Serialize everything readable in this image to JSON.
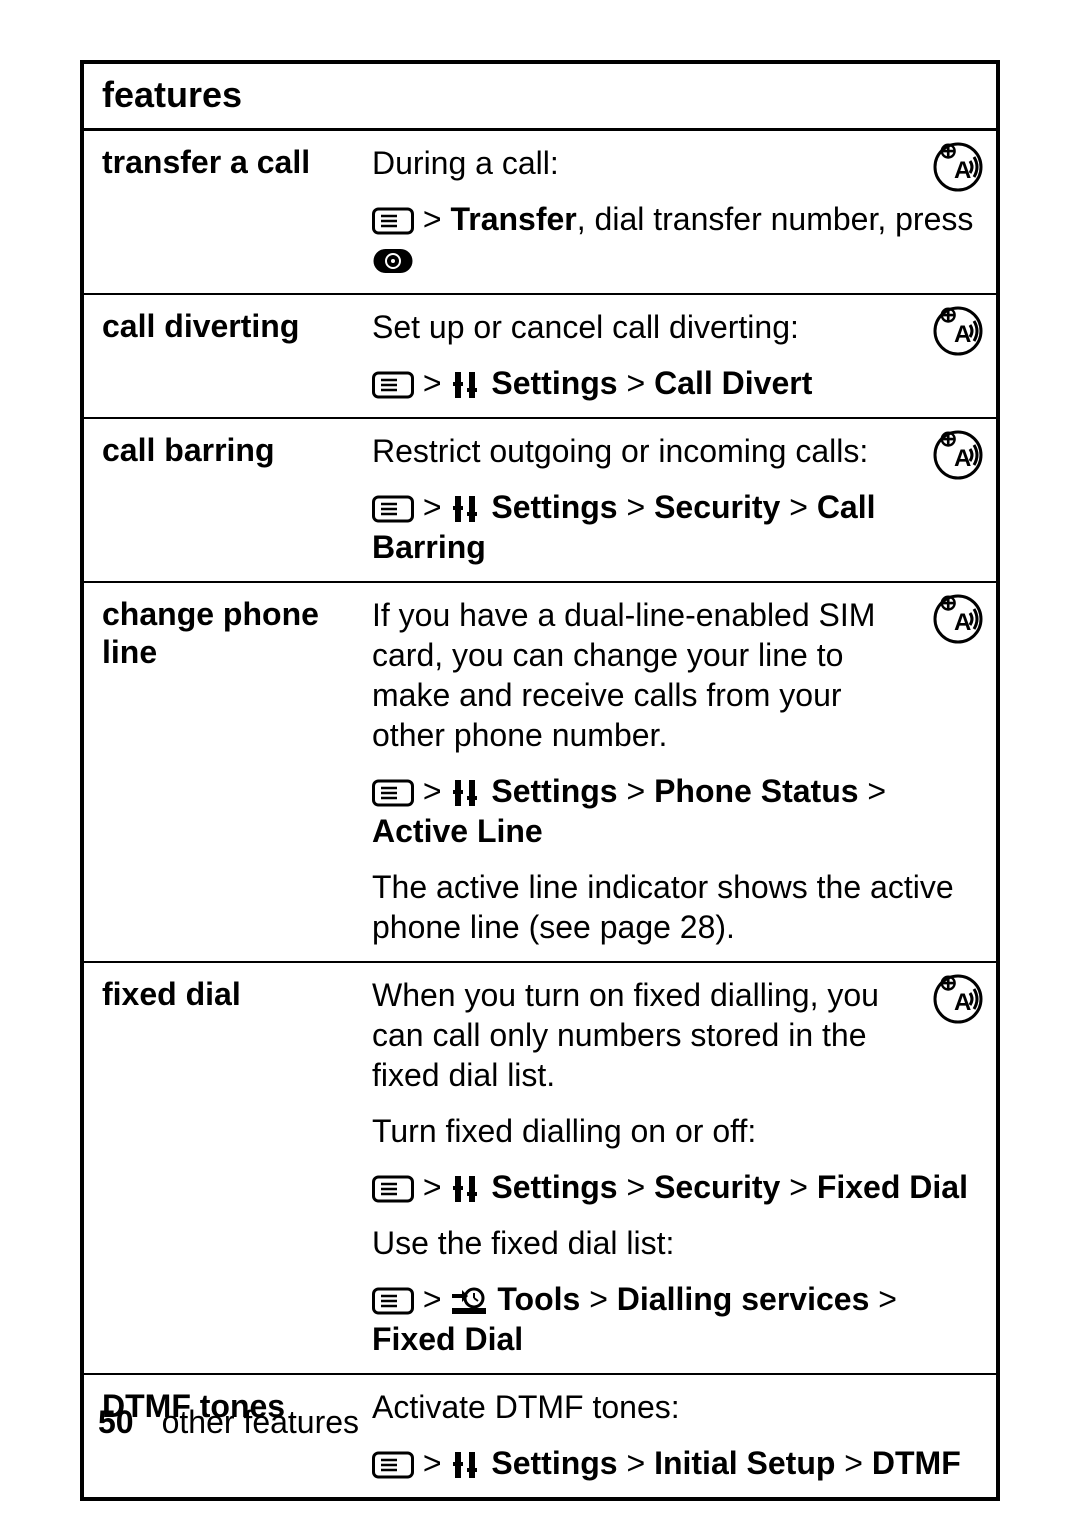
{
  "header": "features",
  "rows": [
    {
      "feature": "transfer a call",
      "badge": true,
      "p1": "During a call:",
      "nav": {
        "pre": "",
        "parts": [
          "Transfer"
        ],
        "tail": ", dial transfer number, press "
      }
    },
    {
      "feature": "call diverting",
      "badge": true,
      "p1": "Set up or cancel call diverting:",
      "nav_settings": [
        "Settings",
        "Call Divert"
      ]
    },
    {
      "feature": "call barring",
      "badge": true,
      "p1": "Restrict outgoing or incoming calls:",
      "nav_settings": [
        "Settings",
        "Security",
        "Call Barring"
      ]
    },
    {
      "feature": "change phone line",
      "badge": true,
      "p1": "If you have a dual-line-enabled SIM card, you can change your line to make and receive calls from your other phone number.",
      "nav_settings": [
        "Settings",
        "Phone Status",
        "Active Line"
      ],
      "p2": "The active line indicator shows the active phone line (see page 28)."
    },
    {
      "feature": "fixed dial",
      "badge": true,
      "p1": "When you turn on fixed dialling, you can call only numbers stored in the fixed dial list.",
      "p2": "Turn fixed dialling on or off:",
      "nav_settings": [
        "Settings",
        "Security",
        "Fixed Dial"
      ],
      "p3": "Use the fixed dial list:",
      "nav_tools": [
        "Tools",
        "Dialling services",
        "Fixed Dial"
      ]
    },
    {
      "feature": "DTMF tones",
      "badge": false,
      "p1": "Activate DTMF tones:",
      "nav_settings": [
        "Settings",
        "Initial Setup",
        "DTMF"
      ]
    }
  ],
  "footer": {
    "page": "50",
    "section": "other features"
  },
  "gt": " > "
}
